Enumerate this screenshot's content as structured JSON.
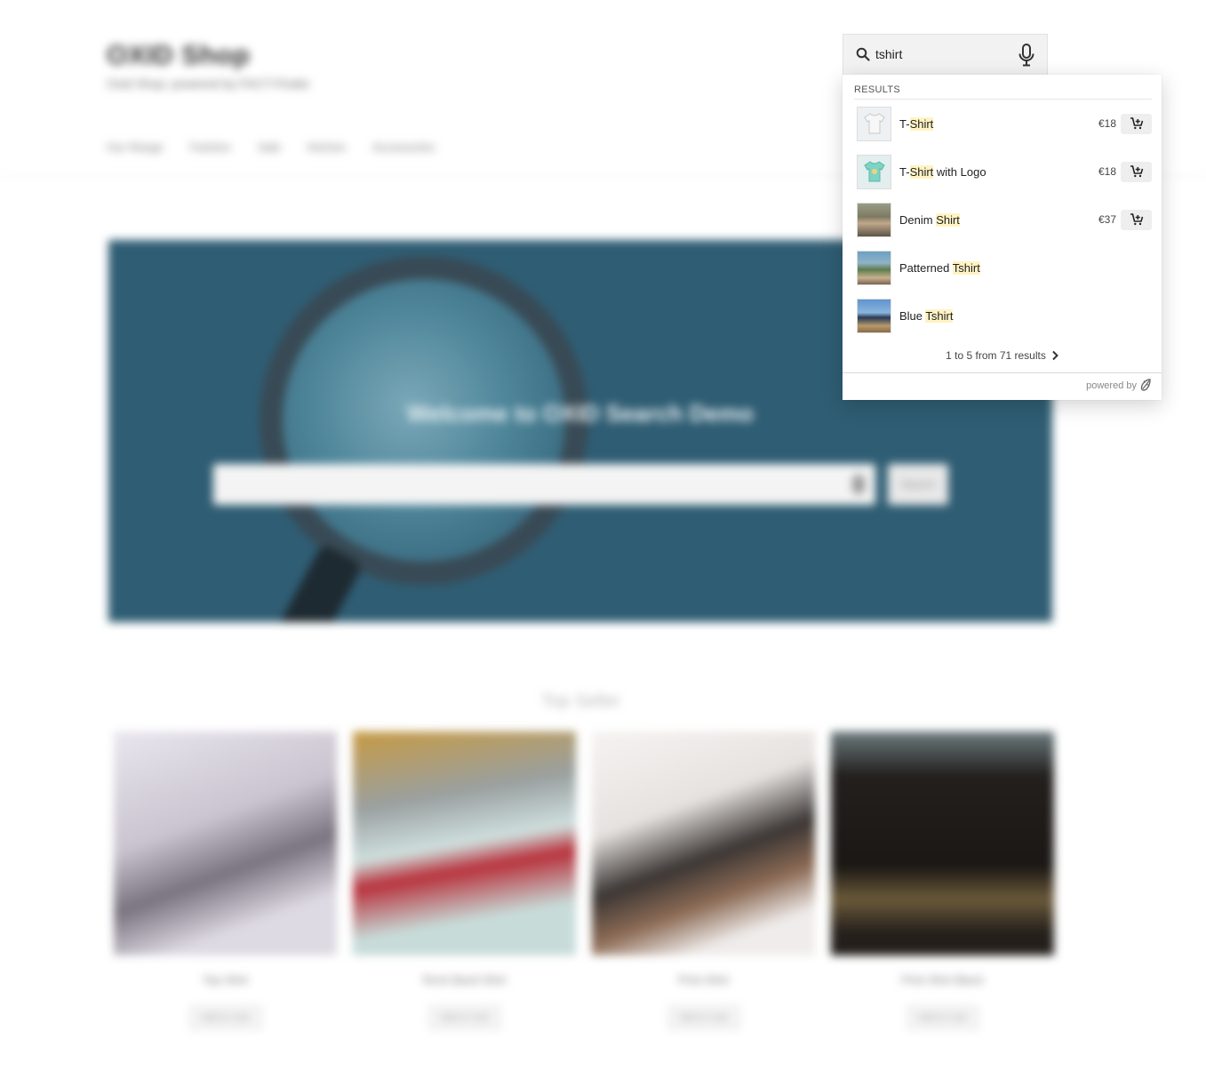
{
  "background": {
    "shop_title": "OXID Shop",
    "shop_tagline": "Oxid Shop: powered by FACT-Finder",
    "nav_items": [
      "Our Range",
      "Fashion",
      "Sale",
      "Kitchen",
      "Accessories"
    ],
    "hero_title": "Welcome to OXID Search Demo",
    "hero_search_button": "Search",
    "section_title": "Top Seller",
    "products": [
      {
        "name": "Top Shirt",
        "button": "Add to Cart"
      },
      {
        "name": "Rock Band Shirt",
        "button": "Add to Cart"
      },
      {
        "name": "Print Shirt",
        "button": "Add to Cart"
      },
      {
        "name": "Print Shirt Black",
        "button": "Add to Cart"
      }
    ]
  },
  "search": {
    "query": "tshirt",
    "icons": {
      "search": "search-icon",
      "mic": "microphone-icon"
    }
  },
  "dropdown": {
    "section_label": "RESULTS",
    "results": [
      {
        "title_pre": "T-",
        "title_hl": "Shirt",
        "title_post": "",
        "price": "€18",
        "has_cart": true,
        "thumb": "white-tshirt"
      },
      {
        "title_pre": "T-",
        "title_hl": "Shirt",
        "title_post": " with Logo",
        "price": "€18",
        "has_cart": true,
        "thumb": "teal-tshirt"
      },
      {
        "title_pre": "Denim ",
        "title_hl": "Shirt",
        "title_post": "",
        "price": "€37",
        "has_cart": true,
        "thumb": "denim-shirt-photo"
      },
      {
        "title_pre": "Patterned ",
        "title_hl": "Tshirt",
        "title_post": "",
        "price": "",
        "has_cart": false,
        "thumb": "patterned-tshirt-photo"
      },
      {
        "title_pre": "Blue ",
        "title_hl": "Tshirt",
        "title_post": "",
        "price": "",
        "has_cart": false,
        "thumb": "blue-tshirt-photo"
      }
    ],
    "pagination": "1 to 5 from 71 results",
    "powered_by": "powered by",
    "highlight_color": "#fff3c4"
  }
}
